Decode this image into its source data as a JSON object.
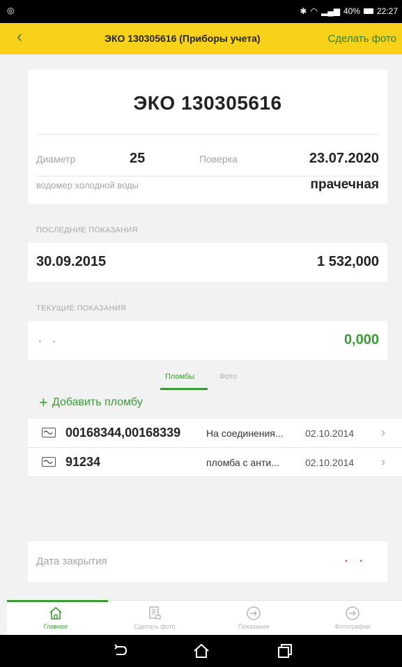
{
  "status_bar": {
    "battery": "40%",
    "time": "22:27"
  },
  "header": {
    "back_icon": "chevron-left-icon",
    "title": "ЭКО 130305616 (Приборы учета)",
    "action_label": "Сделать фото"
  },
  "device": {
    "name": "ЭКО 130305616",
    "diameter_label": "Диаметр",
    "diameter_value": "25",
    "verification_label": "Поверка",
    "verification_value": "23.07.2020",
    "type_label": "водомер холодной воды",
    "location_value": "прачечная"
  },
  "last_reading": {
    "section_label": "ПОСЛЕДНИЕ ПОКАЗАНИЯ",
    "date": "30.09.2015",
    "value": "1 532,000"
  },
  "current_reading": {
    "section_label": "ТЕКУЩИЕ ПОКАЗАНИЯ",
    "date_placeholder": "· ·",
    "value": "0,000"
  },
  "tabs": [
    {
      "label": "Пломбы",
      "active": true
    },
    {
      "label": "Фото",
      "active": false
    }
  ],
  "add_seal_label": "Добавить пломбу",
  "seals": [
    {
      "code": "00168344,00168339",
      "place": "На соединения...",
      "date": "02.10.2014"
    },
    {
      "code": "91234",
      "place": "пломба с анти...",
      "date": "02.10.2014"
    }
  ],
  "closing": {
    "label": "Дата закрытия",
    "value_placeholder": "· ·"
  },
  "bottom_nav": [
    {
      "label": "Главное",
      "icon": "home-icon",
      "active": true
    },
    {
      "label": "Сделать фото",
      "icon": "document-icon",
      "active": false
    },
    {
      "label": "Показания",
      "icon": "arrow-circle-icon",
      "active": false
    },
    {
      "label": "Фотографии",
      "icon": "arrow-circle-icon",
      "active": false
    }
  ],
  "colors": {
    "header_bg": "#f8d21a",
    "accent_green": "#3c9a36",
    "alert_red": "#e53935"
  }
}
